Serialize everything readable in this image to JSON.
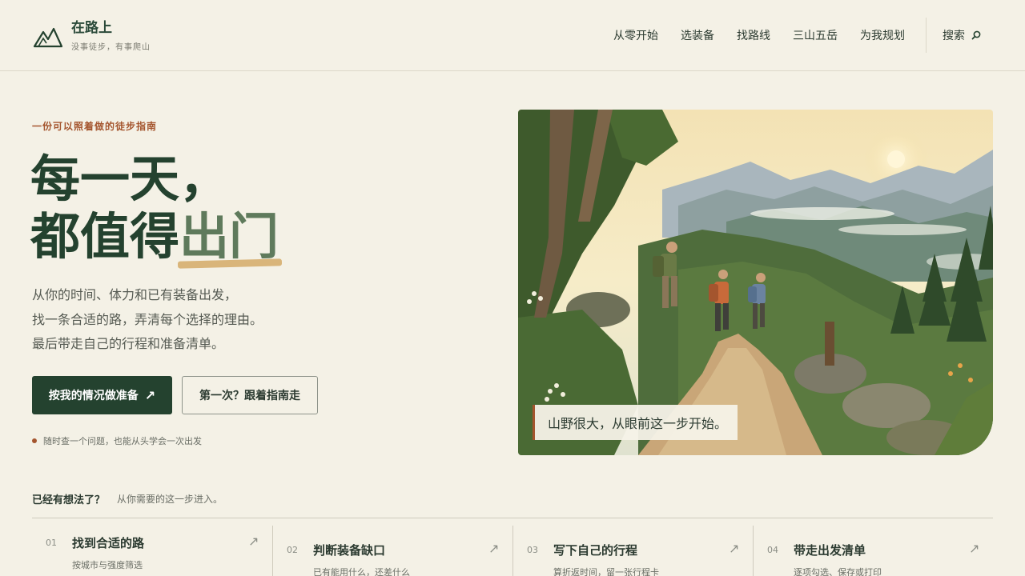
{
  "brand": {
    "title": "在路上",
    "tagline": "没事徒步，有事爬山"
  },
  "nav": {
    "items": [
      "从零开始",
      "选装备",
      "找路线",
      "三山五岳",
      "为我规划"
    ],
    "search_label": "搜索"
  },
  "hero": {
    "eyebrow": "一份可以照着做的徒步指南",
    "title_line1": "每一天，",
    "title_line2_pre": "都值得",
    "title_line2_highlight": "出门",
    "desc": [
      "从你的时间、体力和已有装备出发，",
      "找一条合适的路，弄清每个选择的理由。",
      "最后带走自己的行程和准备清单。"
    ],
    "primary_button": "按我的情况做准备",
    "primary_arrow": "↗",
    "secondary_button": "第一次？跟着指南走",
    "hint": "随时查一个问题，也能从头学会一次出发",
    "image_caption": "山野很大，从眼前这一步开始。"
  },
  "quick": {
    "title": "已经有想法了？",
    "subtitle": "从你需要的这一步进入。",
    "cards": [
      {
        "num": "01",
        "title": "找到合适的路",
        "desc": "按城市与强度筛选",
        "arrow": "↗"
      },
      {
        "num": "02",
        "title": "判断装备缺口",
        "desc": "已有能用什么，还差什么",
        "arrow": "↗"
      },
      {
        "num": "03",
        "title": "写下自己的行程",
        "desc": "算折返时间，留一张行程卡",
        "arrow": "↗"
      },
      {
        "num": "04",
        "title": "带走出发清单",
        "desc": "逐项勾选、保存或打印",
        "arrow": "↗"
      }
    ]
  },
  "colors": {
    "primary": "#24422f",
    "accent": "#a4552e",
    "highlight": "#d9b57a",
    "background": "#f4f1e6"
  }
}
